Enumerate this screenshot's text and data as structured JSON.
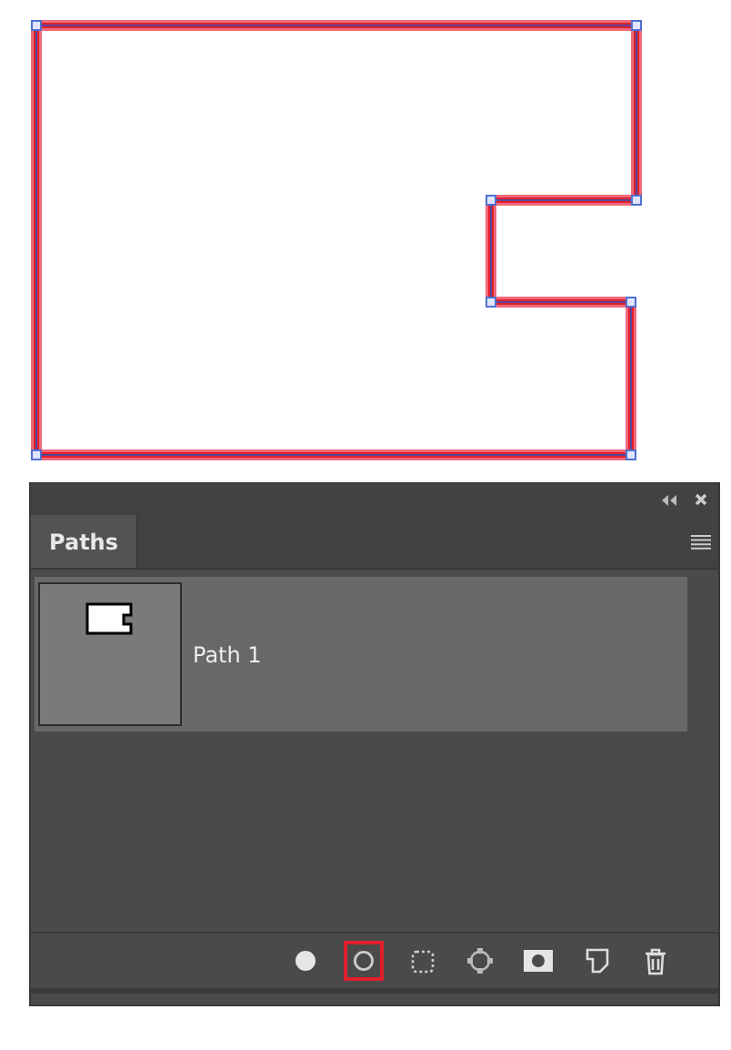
{
  "panel": {
    "tabs": [
      {
        "label": "Paths",
        "selected": true
      }
    ],
    "paths": [
      {
        "name": "Path 1",
        "selected": true
      }
    ],
    "footer_buttons": [
      {
        "kind": "fill",
        "highlighted": false
      },
      {
        "kind": "stroke",
        "highlighted": true
      },
      {
        "kind": "selection",
        "highlighted": false
      },
      {
        "kind": "workpath",
        "highlighted": false
      },
      {
        "kind": "mask",
        "highlighted": false
      },
      {
        "kind": "new",
        "highlighted": false
      },
      {
        "kind": "delete",
        "highlighted": false
      }
    ]
  }
}
